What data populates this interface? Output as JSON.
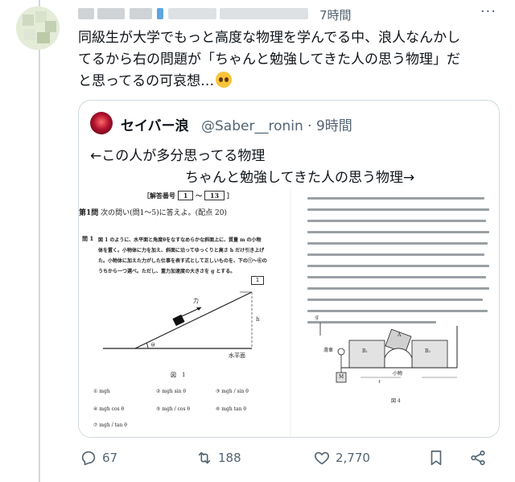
{
  "tweet": {
    "timestamp": "7時間",
    "more_label": "···",
    "text_lines": [
      "同級生が大学でもっと高度な物理を学んでる中、浪人なんかし",
      "てるから右の問題が「ちゃんと勉強してきた人の思う物理」だ",
      "と思ってるの可哀想…"
    ],
    "emoji": "pleading-face-emoji"
  },
  "quote": {
    "name": "セイバー浪",
    "handle": "@Saber__ronin",
    "separator": "·",
    "time": "9時間",
    "line1": "←この人が多分思ってる物理",
    "line2": "ちゃんと勉強してきた人の思う物理→",
    "left_page": {
      "answer_box": "［解答番号",
      "ans_from": "1",
      "tilde": "〜",
      "ans_to": "13",
      "close_bracket": "］",
      "heading": "第1問",
      "heading_rest": "次の問い(問1～5)に答えよ。(配点 20)",
      "q1_label": "問 1",
      "q1_lines": [
        "図 1 のように、水平面と角度θをなすなめらかな斜面上に、質量 m の小物",
        "体を置く。小物体に力を加え、斜面に沿ってゆっくりと高さ h だけ引き上げ",
        "た。小物体に加えた力がした仕事を表す式として正しいものを、下の①～⑥の",
        "うちから一つ選べ。ただし、重力加速度の大きさを g とする。"
      ],
      "q1_box": "1",
      "force_label": "力",
      "h_label": "h",
      "theta_label": "θ",
      "ground_label": "水平面",
      "figure_caption": "図　1",
      "choices": [
        "① mgh",
        "② mgh sin θ",
        "③ mgh / sin θ",
        "④ mgh cos θ",
        "⑤ mgh / cos θ",
        "⑥ mgh tan θ",
        "⑦ mgh / tan θ"
      ]
    },
    "right_page": {
      "caption": "図 4",
      "labels": [
        "B₁",
        "B₂",
        "A",
        "M",
        "滑車",
        "ℓ",
        "小物",
        "g"
      ]
    }
  },
  "actions": {
    "reply_count": "67",
    "retweet_count": "188",
    "like_count": "2,770"
  }
}
